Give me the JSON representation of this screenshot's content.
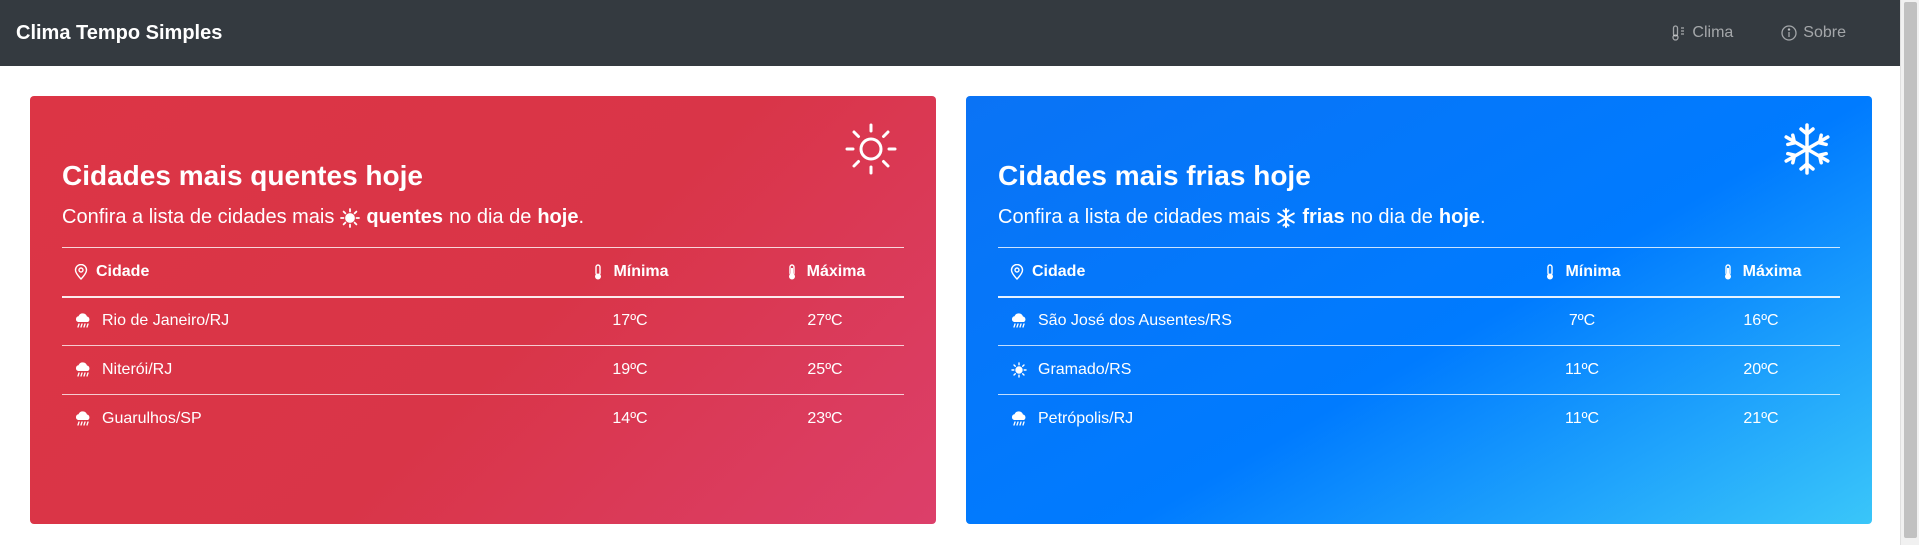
{
  "navbar": {
    "brand": "Clima Tempo Simples",
    "links": [
      {
        "label": "Clima",
        "icon": "thermometer-sun-icon"
      },
      {
        "label": "Sobre",
        "icon": "info-circle-icon"
      }
    ]
  },
  "hot": {
    "title": "Cidades mais quentes hoje",
    "lead_pre": "Confira a lista de cidades mais",
    "lead_bold1": "quentes",
    "lead_mid": "no dia de",
    "lead_bold2": "hoje",
    "lead_end": ".",
    "headers": {
      "city": "Cidade",
      "min": "Mínima",
      "max": "Máxima"
    },
    "rows": [
      {
        "icon": "cloud-rain-icon",
        "city": "Rio de Janeiro/RJ",
        "min": "17ºC",
        "max": "27ºC"
      },
      {
        "icon": "cloud-rain-icon",
        "city": "Niterói/RJ",
        "min": "19ºC",
        "max": "25ºC"
      },
      {
        "icon": "cloud-rain-icon",
        "city": "Guarulhos/SP",
        "min": "14ºC",
        "max": "23ºC"
      }
    ],
    "colors": {
      "start": "#dc3545",
      "end": "#dc3f6a"
    }
  },
  "cold": {
    "title": "Cidades mais frias hoje",
    "lead_pre": "Confira a lista de cidades mais",
    "lead_bold1": "frias",
    "lead_mid": "no dia de",
    "lead_bold2": "hoje",
    "lead_end": ".",
    "headers": {
      "city": "Cidade",
      "min": "Mínima",
      "max": "Máxima"
    },
    "rows": [
      {
        "icon": "cloud-rain-icon",
        "city": "São José dos Ausentes/RS",
        "min": "7ºC",
        "max": "16ºC"
      },
      {
        "icon": "sun-icon",
        "city": "Gramado/RS",
        "min": "11ºC",
        "max": "20ºC"
      },
      {
        "icon": "cloud-rain-icon",
        "city": "Petrópolis/RJ",
        "min": "11ºC",
        "max": "21ºC"
      }
    ],
    "colors": {
      "start": "#007bff",
      "end": "#3ac6f9"
    }
  }
}
